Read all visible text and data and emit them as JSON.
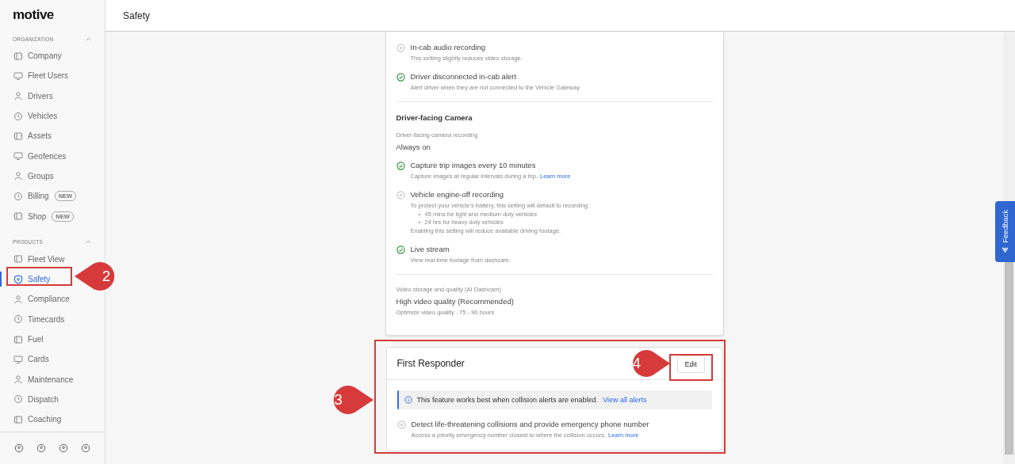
{
  "sidebar": {
    "logo": "motive",
    "sections": [
      {
        "heading": "ORGANIZATION",
        "expanded": true,
        "items": [
          {
            "label": "Company",
            "selected": false
          },
          {
            "label": "Fleet Users",
            "selected": false
          },
          {
            "label": "Drivers",
            "selected": false
          },
          {
            "label": "Vehicles",
            "selected": false
          },
          {
            "label": "Assets",
            "selected": false
          },
          {
            "label": "Geofences",
            "selected": false
          },
          {
            "label": "Groups",
            "selected": false
          },
          {
            "label": "Billing",
            "selected": false,
            "badge": "NEW"
          },
          {
            "label": "Shop",
            "selected": false,
            "badge": "NEW"
          }
        ]
      },
      {
        "heading": "PRODUCTS",
        "expanded": true,
        "items": [
          {
            "label": "Fleet View",
            "selected": false
          },
          {
            "label": "Safety",
            "selected": true
          },
          {
            "label": "Compliance",
            "selected": false
          },
          {
            "label": "Timecards",
            "selected": false
          },
          {
            "label": "Fuel",
            "selected": false
          },
          {
            "label": "Cards",
            "selected": false
          },
          {
            "label": "Maintenance",
            "selected": false
          },
          {
            "label": "Dispatch",
            "selected": false
          },
          {
            "label": "Coaching",
            "selected": false
          }
        ]
      }
    ]
  },
  "header": {
    "title": "Safety"
  },
  "dashcam_card": {
    "sections": [
      {
        "items": [
          {
            "kind": "toggle",
            "enabled": false,
            "title": "In-cab audio recording",
            "description": "This setting slightly reduces video storage."
          },
          {
            "kind": "toggle",
            "enabled": true,
            "title": "Driver disconnected in-cab alert",
            "description": "Alert driver when they are not connected to the Vehicle Gateway"
          }
        ]
      },
      {
        "heading": "Driver-facing Camera",
        "items": [
          {
            "kind": "field",
            "label": "Driver-facing camera recording",
            "value": "Always on"
          },
          {
            "kind": "toggle",
            "enabled": true,
            "title": "Capture trip images every 10 minutes",
            "description": "Capture images at regular intervals during a trip.",
            "link": "Learn more"
          },
          {
            "kind": "toggle",
            "enabled": false,
            "title": "Vehicle engine-off recording",
            "description": "To protect your vehicle's battery, this setting will default to recording:",
            "bullets": [
              "45 mins for light and medium duty vehicles",
              "24 hrs for heavy duty vehicles"
            ],
            "note": "Enabling this setting will reduce available driving footage."
          },
          {
            "kind": "toggle",
            "enabled": true,
            "title": "Live stream",
            "description": "View real-time footage from dashcam."
          }
        ]
      },
      {
        "items": [
          {
            "kind": "field",
            "label": "Video storage and quality (AI Dashcam)",
            "value": "High video quality (Recommended)",
            "hint": "Optimize video quality . 75 - 90 hours"
          }
        ]
      }
    ]
  },
  "first_responder": {
    "title": "First Responder",
    "edit_button": "Edit",
    "info": {
      "text": "This feature works best when collision alerts are enabled.",
      "link": "View all alerts"
    },
    "items": [
      {
        "kind": "toggle",
        "enabled": false,
        "title": "Detect life-threatening collisions and provide emergency phone number",
        "description": "Access a priority emergency number closest to where the collision occurs.",
        "link": "Learn more"
      }
    ]
  },
  "feedback_tab": {
    "label": "Feedback"
  },
  "annotations": [
    {
      "label": "2"
    },
    {
      "label": "3"
    },
    {
      "label": "4"
    }
  ]
}
